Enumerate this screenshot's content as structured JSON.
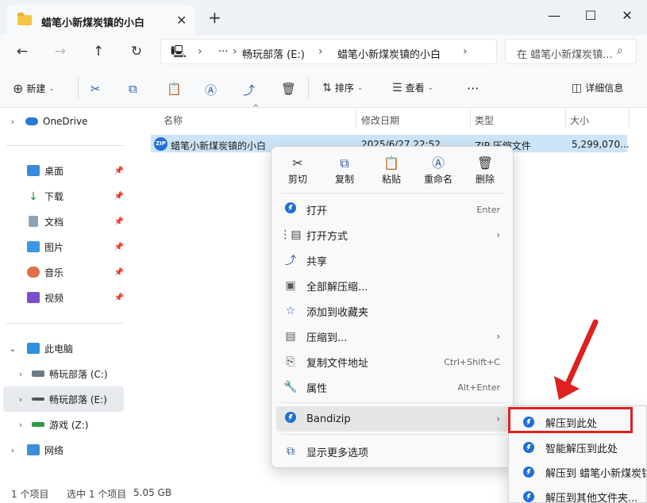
{
  "window": {
    "tab_title": "蜡笔小新煤炭镇的小白",
    "tab_close": "✕",
    "new_tab": "+",
    "minimize": "—",
    "maximize": "☐",
    "close": "✕"
  },
  "address": {
    "more": "···",
    "drive": "畅玩部落 (E:)",
    "folder": "蜡笔小新煤炭镇的小白",
    "search_placeholder": "在 蜡笔小新煤炭镇..."
  },
  "toolbar": {
    "new_label": "新建",
    "sort_label": "排序",
    "view_label": "查看",
    "more": "···",
    "details_label": "详细信息"
  },
  "sidebar": {
    "onedrive": "OneDrive",
    "quick": [
      "桌面",
      "下载",
      "文档",
      "图片",
      "音乐",
      "视频"
    ],
    "this_pc": "此电脑",
    "drives": [
      "畅玩部落 (C:)",
      "畅玩部落 (E:)",
      "游戏 (Z:)"
    ],
    "network": "网络"
  },
  "columns": {
    "name": "名称",
    "modified": "修改日期",
    "type": "类型",
    "size": "大小"
  },
  "file": {
    "name": "蜡笔小新煤炭镇的小白",
    "modified": "2025/6/27 22:52",
    "type": "ZIP 压缩文件",
    "size": "5,299,070..."
  },
  "status": {
    "count": "1 个项目",
    "selected": "选中 1 个项目",
    "size": "5.05 GB"
  },
  "context_menu": {
    "quick_actions": [
      "剪切",
      "复制",
      "粘贴",
      "重命名",
      "删除"
    ],
    "items": [
      {
        "label": "打开",
        "shortcut": "Enter"
      },
      {
        "label": "打开方式",
        "shortcut": ""
      },
      {
        "label": "共享",
        "shortcut": ""
      },
      {
        "label": "全部解压缩...",
        "shortcut": ""
      },
      {
        "label": "添加到收藏夹",
        "shortcut": ""
      },
      {
        "label": "压缩到...",
        "shortcut": ""
      },
      {
        "label": "复制文件地址",
        "shortcut": "Ctrl+Shift+C"
      },
      {
        "label": "属性",
        "shortcut": "Alt+Enter"
      }
    ],
    "bandizip": "Bandizip",
    "more_options": "显示更多选项"
  },
  "submenu": {
    "items": [
      "解压到此处",
      "智能解压到此处",
      "解压到 蜡笔小新煤炭镇",
      "解压到其他文件夹..."
    ]
  },
  "colors": {
    "accent": "#2a5ea6",
    "selection": "#cce4f7",
    "highlight_box": "#e02020"
  }
}
